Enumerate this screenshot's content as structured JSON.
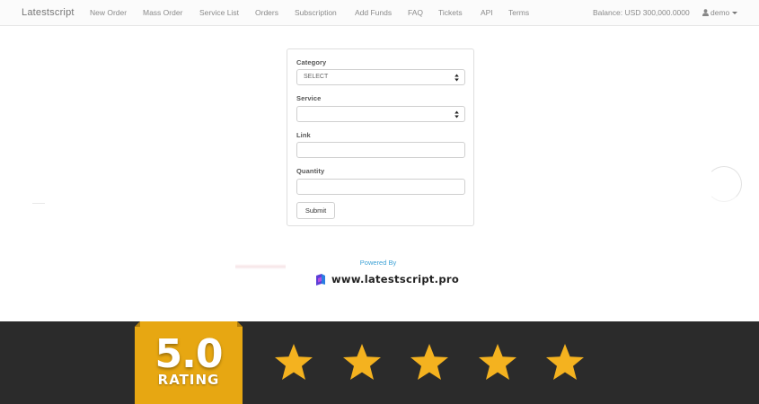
{
  "navbar": {
    "brand": "Latestscript",
    "items": [
      {
        "label": "New Order"
      },
      {
        "label": "Mass Order"
      },
      {
        "label": "Service List"
      },
      {
        "label": "Orders"
      },
      {
        "label": "Subscription"
      },
      {
        "label": "Add Funds"
      },
      {
        "label": "FAQ"
      },
      {
        "label": "Tickets"
      },
      {
        "label": "API"
      },
      {
        "label": "Terms"
      }
    ],
    "balance": "Balance: USD 300,000.0000",
    "user": "demo",
    "user_icon": "user-icon"
  },
  "form": {
    "category_label": "Category",
    "category_value": "SELECT",
    "service_label": "Service",
    "service_value": "",
    "link_label": "Link",
    "link_value": "",
    "quantity_label": "Quantity",
    "quantity_value": "",
    "submit_label": "Submit"
  },
  "footer": {
    "powered_by": "Powered By",
    "site": "www.latestscript.pro"
  },
  "rating": {
    "score": "5.0",
    "label": "RATING",
    "stars": 5,
    "max_stars": 5,
    "badge_color": "#e7a712",
    "star_color": "#f4b21f",
    "band_color": "#2b2b2b"
  }
}
